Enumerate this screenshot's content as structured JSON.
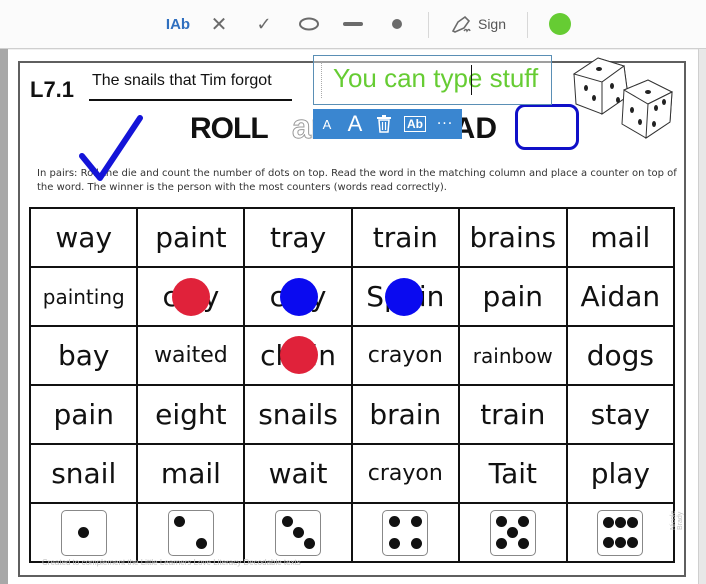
{
  "toolbar": {
    "text_tool": "IAb",
    "cross_tool": "✕",
    "check_tool": "✓",
    "sign_label": "Sign",
    "current_color": "#66cc33"
  },
  "worksheet": {
    "lesson": "L7.1",
    "story_title": "The snails that Tim forgot",
    "heading_roll": "ROLL",
    "heading_and": "and",
    "heading_read": "READ",
    "instructions": "In pairs: Roll the die and count the number of dots on top. Read the word in the matching column and place a counter on top of the word. The winner is the person with the most counters (words read correctly).",
    "footer": "Created to complement the Little Learners Love Literacy Decodable texts",
    "credit": "Nicole Brady",
    "rows": [
      [
        "way",
        "paint",
        "tray",
        "train",
        "brains",
        "mail"
      ],
      [
        "painting",
        "clay",
        "clay",
        "Spain",
        "pain",
        "Aidan"
      ],
      [
        "bay",
        "waited",
        "chain",
        "crayon",
        "rainbow",
        "dogs"
      ],
      [
        "pain",
        "eight",
        "snails",
        "brain",
        "train",
        "stay"
      ],
      [
        "snail",
        "mail",
        "wait",
        "crayon",
        "Tait",
        "play"
      ]
    ],
    "dice_values": [
      1,
      2,
      3,
      4,
      5,
      6
    ]
  },
  "annotation": {
    "textbox_value": "You can type stuff",
    "format_bar": {
      "decrease_font": "A",
      "increase_font": "A",
      "more": "···"
    },
    "counters": [
      {
        "row": 1,
        "col": 1,
        "color": "#e0223a"
      },
      {
        "row": 1,
        "col": 2,
        "color": "#0a0af0"
      },
      {
        "row": 1,
        "col": 3,
        "color": "#0a0af0"
      },
      {
        "row": 2,
        "col": 2,
        "color": "#e0223a"
      }
    ],
    "checkmark_color": "#1414d8"
  }
}
